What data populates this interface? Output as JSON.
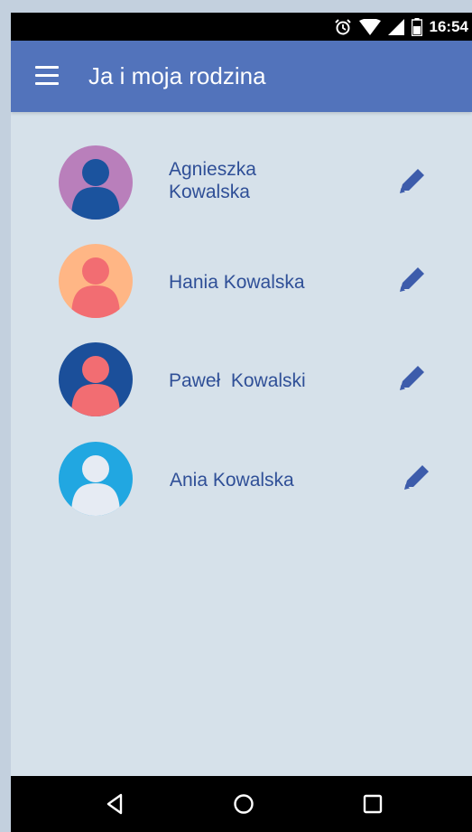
{
  "status_bar": {
    "time": "16:54",
    "icons": [
      "alarm-icon",
      "wifi-icon",
      "signal-icon",
      "battery-icon"
    ]
  },
  "app_bar": {
    "title": "Ja i moja rodzina",
    "menu_icon": "hamburger-menu-icon",
    "color": "#5273bb"
  },
  "family": [
    {
      "name": "Agnieszka Kowalska",
      "line1": "Agnieszka",
      "line2": "Kowalska",
      "avatar_bg": "#b97fbb",
      "avatar_fg": "#1b539e",
      "edit_icon": "pencil-icon"
    },
    {
      "name": "Hania Kowalska",
      "avatar_bg": "#ffb685",
      "avatar_fg": "#f26d72",
      "edit_icon": "pencil-icon"
    },
    {
      "name": "Paweł  Kowalski",
      "avatar_bg": "#1b4f9a",
      "avatar_fg": "#f26d72",
      "edit_icon": "pencil-icon"
    },
    {
      "name": "Ania Kowalska",
      "avatar_bg": "#21a7e1",
      "avatar_fg": "#e6ebf3",
      "edit_icon": "pencil-icon"
    }
  ],
  "nav_bar": {
    "buttons": [
      "back-triangle-icon",
      "home-circle-icon",
      "recents-square-icon"
    ]
  },
  "colors": {
    "name_text": "#2f4f97",
    "background": "#d6e1ea",
    "edit_icon": "#3d5cab"
  }
}
